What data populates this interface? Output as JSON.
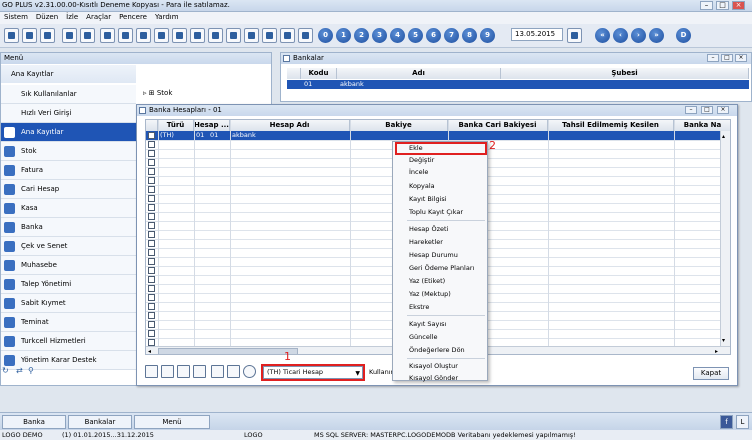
{
  "window": {
    "title": "GO PLUS v2.31.00.00-Kısıtlı Deneme Kopyası - Para ile satılamaz."
  },
  "menubar": [
    "Sistem",
    "Düzen",
    "İzle",
    "Araçlar",
    "Pencere",
    "Yardım"
  ],
  "toolbar": {
    "date": "13.05.2015",
    "numbers": [
      "0",
      "1",
      "2",
      "3",
      "4",
      "5",
      "6",
      "7",
      "8",
      "9"
    ],
    "d_label": "D"
  },
  "menu_panel": {
    "title": "Menü",
    "header": "Ana Kayıtlar",
    "items": [
      "Sık Kullanılanlar",
      "Hızlı Veri Girişi",
      "Ana Kayıtlar",
      "Stok",
      "Fatura",
      "Cari Hesap",
      "Kasa",
      "Banka",
      "Çek ve Senet",
      "Muhasebe",
      "Talep Yönetimi",
      "Sabit Kıymet",
      "Teminat",
      "Turkcell Hizmetleri",
      "Yönetim Karar Destek"
    ],
    "tree_item": "Stok"
  },
  "bankalar": {
    "title": "Bankalar",
    "columns": [
      "Kodu",
      "Adı",
      "Şubesi"
    ],
    "row": {
      "kodu": "01",
      "adi": "akbank",
      "subesi": ""
    }
  },
  "hesap": {
    "title": "Banka Hesapları - 01",
    "columns": [
      "Türü",
      "Hesap ...",
      "Hesap Adı",
      "Bakiye",
      "Banka Cari Bakiyesi",
      "Tahsil Edilmemiş Kesilen Çekler...",
      "Banka Na"
    ],
    "row": {
      "turu": "(TH)",
      "hesap1": "01",
      "hesap2": "01",
      "hesap_adi": "akbank"
    },
    "combo": "(TH) Ticari Hesap",
    "kullanim": "Kullanımlar",
    "close": "Kapat"
  },
  "context_menu": {
    "items": [
      "Ekle",
      "Değiştir",
      "İncele",
      "Kopyala",
      "Kayıt Bilgisi",
      "Toplu Kayıt Çıkar",
      "Hesap Özeti",
      "Hareketler",
      "Hesap Durumu",
      "Geri Ödeme Planları",
      "Yaz (Etiket)",
      "Yaz (Mektup)",
      "Ekstre",
      "Kayıt Sayısı",
      "Güncelle",
      "Öndeğerlere Dön",
      "Kısayol Oluştur",
      "Kısayol Gönder"
    ]
  },
  "annotations": {
    "one": "1",
    "two": "2"
  },
  "taskbar": [
    "Banka Hesapları...",
    "Bankalar",
    "Menü"
  ],
  "status": {
    "left": "LOGO DEMO",
    "period": "(1) 01.01.2015...31.12.2015",
    "user": "LOGO",
    "server": "MS SQL SERVER: MASTERPC.LOGODEMODB Veritabanı yedeklemesi yapılmamış!"
  },
  "colors": {
    "selection": "#1f55b5",
    "highlight": "#e02020"
  }
}
